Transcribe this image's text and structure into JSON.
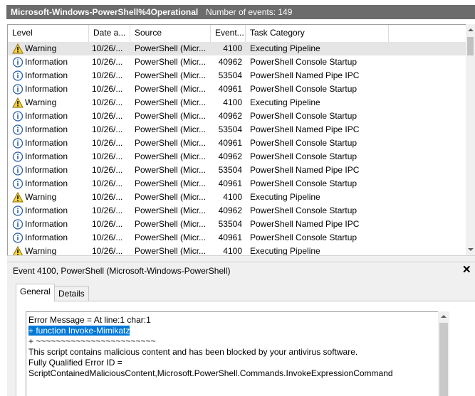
{
  "log": {
    "name": "Microsoft-Windows-PowerShell%4Operational",
    "count_text": "Number of events: 149"
  },
  "columns": {
    "level": "Level",
    "date": "Date a...",
    "source": "Source",
    "event_id": "Event...",
    "task": "Task Category"
  },
  "icons": {
    "warning": "warning-triangle-icon",
    "information": "information-circle-icon"
  },
  "colors": {
    "warning_fill": "#f4d03f",
    "info_stroke": "#2a5ea8",
    "selection": "#0078d7"
  },
  "events": [
    {
      "level": "Warning",
      "date": "10/26/...",
      "source": "PowerShell (Micr...",
      "event_id": "4100",
      "task": "Executing Pipeline"
    },
    {
      "level": "Information",
      "date": "10/26/...",
      "source": "PowerShell (Micr...",
      "event_id": "40962",
      "task": "PowerShell Console Startup"
    },
    {
      "level": "Information",
      "date": "10/26/...",
      "source": "PowerShell (Micr...",
      "event_id": "53504",
      "task": "PowerShell Named Pipe IPC"
    },
    {
      "level": "Information",
      "date": "10/26/...",
      "source": "PowerShell (Micr...",
      "event_id": "40961",
      "task": "PowerShell Console Startup"
    },
    {
      "level": "Warning",
      "date": "10/26/...",
      "source": "PowerShell (Micr...",
      "event_id": "4100",
      "task": "Executing Pipeline"
    },
    {
      "level": "Information",
      "date": "10/26/...",
      "source": "PowerShell (Micr...",
      "event_id": "40962",
      "task": "PowerShell Console Startup"
    },
    {
      "level": "Information",
      "date": "10/26/...",
      "source": "PowerShell (Micr...",
      "event_id": "53504",
      "task": "PowerShell Named Pipe IPC"
    },
    {
      "level": "Information",
      "date": "10/26/...",
      "source": "PowerShell (Micr...",
      "event_id": "40961",
      "task": "PowerShell Console Startup"
    },
    {
      "level": "Information",
      "date": "10/26/...",
      "source": "PowerShell (Micr...",
      "event_id": "40962",
      "task": "PowerShell Console Startup"
    },
    {
      "level": "Information",
      "date": "10/26/...",
      "source": "PowerShell (Micr...",
      "event_id": "53504",
      "task": "PowerShell Named Pipe IPC"
    },
    {
      "level": "Information",
      "date": "10/26/...",
      "source": "PowerShell (Micr...",
      "event_id": "40961",
      "task": "PowerShell Console Startup"
    },
    {
      "level": "Warning",
      "date": "10/26/...",
      "source": "PowerShell (Micr...",
      "event_id": "4100",
      "task": "Executing Pipeline"
    },
    {
      "level": "Information",
      "date": "10/26/...",
      "source": "PowerShell (Micr...",
      "event_id": "40962",
      "task": "PowerShell Console Startup"
    },
    {
      "level": "Information",
      "date": "10/26/...",
      "source": "PowerShell (Micr...",
      "event_id": "53504",
      "task": "PowerShell Named Pipe IPC"
    },
    {
      "level": "Information",
      "date": "10/26/...",
      "source": "PowerShell (Micr...",
      "event_id": "40961",
      "task": "PowerShell Console Startup"
    },
    {
      "level": "Warning",
      "date": "10/26/...",
      "source": "PowerShell (Micr...",
      "event_id": "4100",
      "task": "Executing Pipeline"
    }
  ],
  "detail": {
    "title": "Event 4100, PowerShell (Microsoft-Windows-PowerShell)",
    "close": "✕",
    "tabs": {
      "general": "General",
      "details": "Details"
    },
    "message": {
      "line1": "Error Message = At line:1 char:1",
      "line2": "+ function Invoke-Mimikatz",
      "line3": "+ ~~~~~~~~~~~~~~~~~~~~~~~~",
      "line4": "This script contains malicious content and has been blocked by your antivirus software.",
      "line5": "Fully Qualified Error ID =",
      "line6": "ScriptContainedMaliciousContent,Microsoft.PowerShell.Commands.InvokeExpressionCommand"
    }
  }
}
